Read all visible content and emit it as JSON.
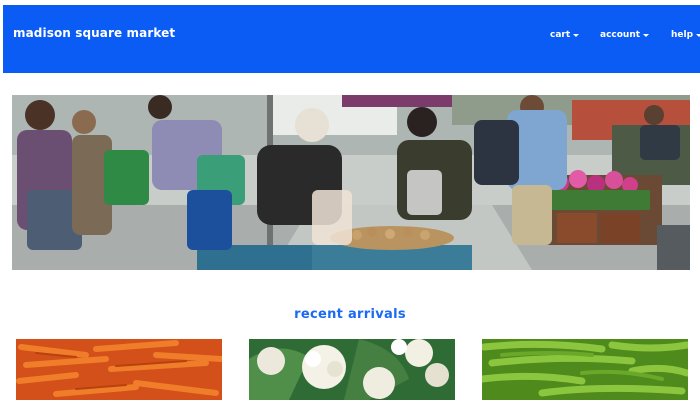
{
  "header": {
    "brand": "madison square market",
    "nav": [
      {
        "label": "cart"
      },
      {
        "label": "account"
      },
      {
        "label": "help"
      }
    ]
  },
  "hero": {
    "image": "outdoor farmers market with shoppers choosing vegetables"
  },
  "recent_arrivals": {
    "title": "recent arrivals",
    "products": [
      {
        "image": "carrots"
      },
      {
        "image": "cauliflower"
      },
      {
        "image": "green beans"
      }
    ]
  },
  "colors": {
    "header_bg": "#0a5cf5",
    "header_text": "#ffffff",
    "section_title": "#1a6af2"
  }
}
